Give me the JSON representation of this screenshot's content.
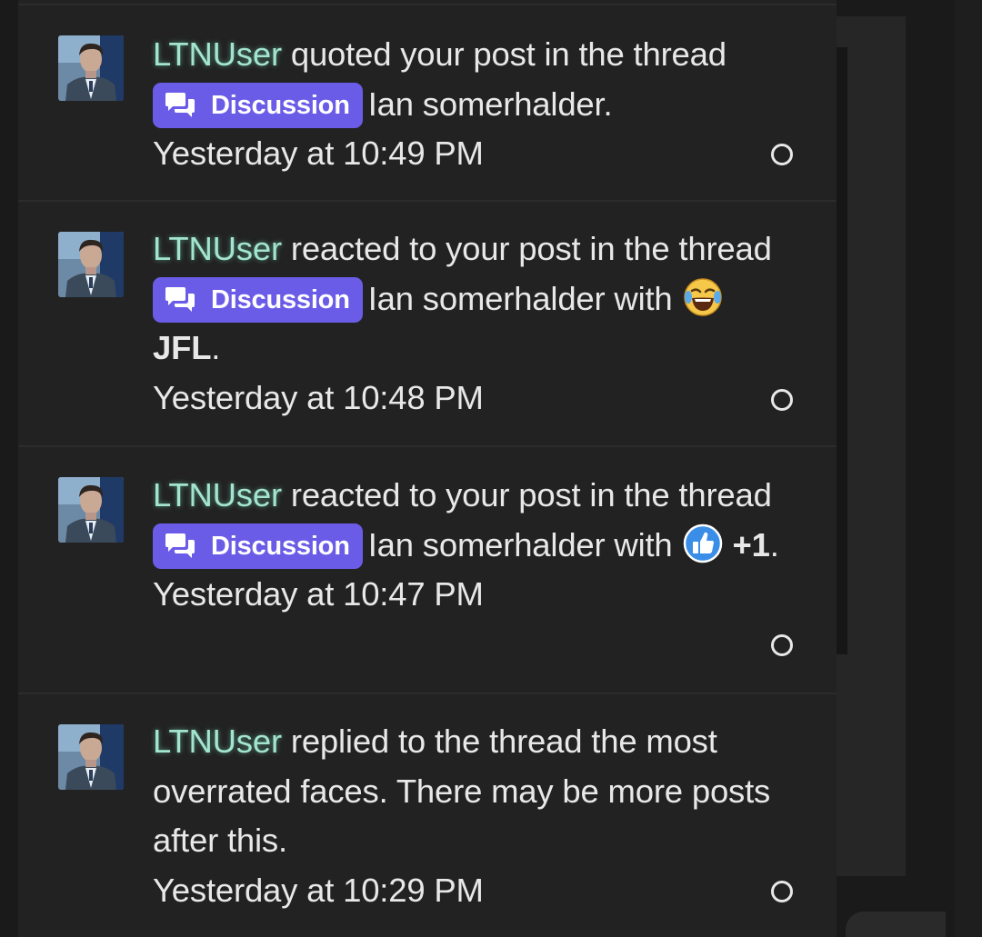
{
  "alerts": [
    {
      "username": "LTNUser",
      "action": " quoted your post in the thread ",
      "prefix_label": "Discussion",
      "thread_title": "Ian somerhalder",
      "end_text": ".",
      "timestamp": "Yesterday at 10:49 PM"
    },
    {
      "username": "LTNUser",
      "action": " reacted to your post in the thread ",
      "prefix_label": "Discussion",
      "thread_title": "Ian somerhalder",
      "with_text": " with ",
      "reaction_icon": "laughing-crying-emoji-icon",
      "reaction_name": "JFL",
      "end_text": ".",
      "timestamp": "Yesterday at 10:48 PM"
    },
    {
      "username": "LTNUser",
      "action": " reacted to your post in the thread ",
      "prefix_label": "Discussion",
      "thread_title": "Ian somerhalder",
      "with_text": " with ",
      "reaction_icon": "thumbs-up-emoji-icon",
      "reaction_name": "+1",
      "end_text": ".",
      "timestamp": "Yesterday at 10:47 PM"
    },
    {
      "username": "LTNUser",
      "action": " replied to the thread ",
      "thread_title": "the most overrated faces",
      "end_text": ". There may be more posts after this.",
      "timestamp": "Yesterday at 10:29 PM"
    }
  ],
  "colors": {
    "username": "#a3e4d0",
    "prefix_bg": "#6b5ce7",
    "panel_bg": "#222222",
    "text": "#e8e8e8"
  }
}
